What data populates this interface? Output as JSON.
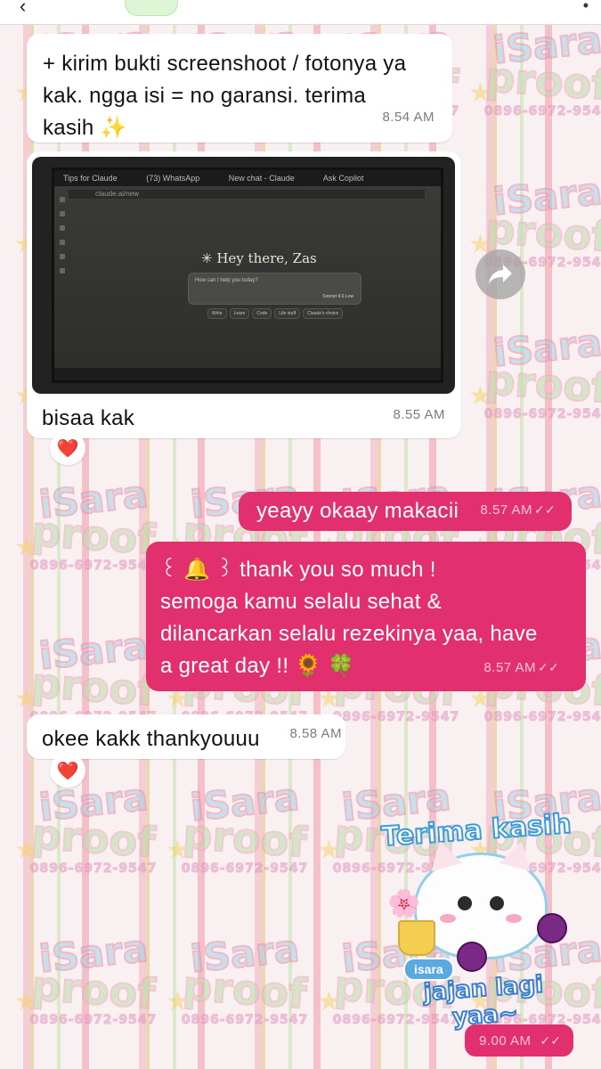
{
  "colors": {
    "outgoing_bubble": "#e2306f",
    "incoming_bubble": "#ffffff",
    "wallpaper_pink": "#f4c9cf"
  },
  "watermark": {
    "line1": "iSara",
    "line2": "proof",
    "phone": "0896-6972-9547"
  },
  "messages": [
    {
      "id": "m1",
      "direction": "incoming",
      "text_lines": [
        "+ kirim bukti screenshoot / fotonya ya",
        "kak. ngga isi = no garansi. terima",
        "kasih ✨"
      ],
      "time": "8.54 AM"
    },
    {
      "id": "m2",
      "direction": "incoming",
      "type": "photo",
      "photo": {
        "tabs": [
          "Tips for Claude",
          "(73) WhatsApp",
          "New chat - Claude",
          "Ask Copilot"
        ],
        "url": "claude.ai/new",
        "greeting": "✳ Hey there, Zas",
        "prompt_placeholder": "How can I help you today?",
        "model_label": "Sonnet 4.6  Low",
        "chips": [
          "Write",
          "Learn",
          "Code",
          "Life stuff",
          "Claude's choice"
        ]
      },
      "caption": "bisaa kak",
      "time": "8.55 AM",
      "reaction": "❤️"
    },
    {
      "id": "m3",
      "direction": "outgoing",
      "text": "yeayy okaay makacii",
      "time": "8.57 AM",
      "ticks": "✓✓"
    },
    {
      "id": "m4",
      "direction": "outgoing",
      "text_lines": [
        "꒰ 🔔 ꒱ thank you so much !",
        "semoga kamu selalu sehat &",
        "dilancarkan selalu rezekinya yaa, have",
        "a great day !! 🌻 🍀"
      ],
      "time": "8.57 AM",
      "ticks": "✓✓"
    },
    {
      "id": "m5",
      "direction": "incoming",
      "text": "okee kakk thankyouuu",
      "time": "8.58 AM",
      "reaction": "❤️"
    },
    {
      "id": "m6",
      "direction": "outgoing",
      "type": "sticker",
      "sticker": {
        "top_text": "Terima kasih",
        "badge": "isara",
        "bottom_text": "jajan lagi yaa~"
      },
      "time": "9.00 AM",
      "ticks": "✓✓"
    }
  ]
}
